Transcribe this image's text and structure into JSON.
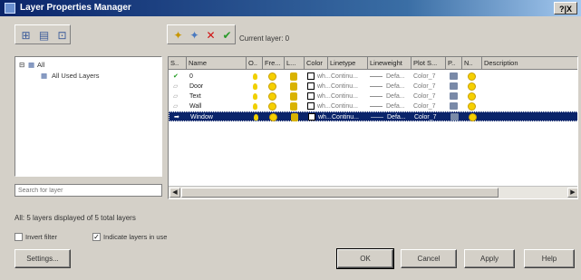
{
  "window": {
    "title": "Layer Properties Manager",
    "controls": "?|X"
  },
  "filter_toolbar": [
    {
      "icon": "new-property-filter-icon",
      "glyph": "⊞"
    },
    {
      "icon": "new-group-filter-icon",
      "glyph": "▤"
    },
    {
      "icon": "layer-states-icon",
      "glyph": "⊡"
    }
  ],
  "layer_toolbar": [
    {
      "icon": "new-layer-icon",
      "glyph": "✦",
      "color": "#c89600"
    },
    {
      "icon": "new-layer-vp-frozen-icon",
      "glyph": "✦",
      "color": "#4a7ac0"
    },
    {
      "icon": "delete-layer-icon",
      "glyph": "✕",
      "color": "#d01010"
    },
    {
      "icon": "set-current-icon",
      "glyph": "✔",
      "color": "#2a9a2a"
    }
  ],
  "current_layer": "Current layer: 0",
  "tree": {
    "root": "All",
    "child": "All Used Layers"
  },
  "search": {
    "placeholder": "Search for layer"
  },
  "columns": [
    "S..",
    "Name",
    "O..",
    "Fre...",
    "L...",
    "Color",
    "Linetype",
    "Lineweight",
    "Plot S...",
    "P..",
    "N..",
    "Description"
  ],
  "layers": [
    {
      "status": "current",
      "name": "0",
      "color": "wh...",
      "linetype": "Continu...",
      "lineweight": "Defa...",
      "plot_style": "Color_7",
      "selected": false
    },
    {
      "status": "",
      "name": "Door",
      "color": "wh...",
      "linetype": "Continu...",
      "lineweight": "Defa...",
      "plot_style": "Color_7",
      "selected": false
    },
    {
      "status": "",
      "name": "Text",
      "color": "wh...",
      "linetype": "Continu...",
      "lineweight": "Defa...",
      "plot_style": "Color_7",
      "selected": false
    },
    {
      "status": "",
      "name": "Wall",
      "color": "wh...",
      "linetype": "Continu...",
      "lineweight": "Defa...",
      "plot_style": "Color_7",
      "selected": false
    },
    {
      "status": "",
      "name": "Window",
      "color": "wh...",
      "linetype": "Continu...",
      "lineweight": "Defa...",
      "plot_style": "Color_7",
      "selected": true
    }
  ],
  "status_text": "All: 5 layers displayed of 5 total layers",
  "invert_filter": {
    "label": "Invert filter",
    "checked": false
  },
  "indicate_layers": {
    "label": "Indicate layers in use",
    "checked": true
  },
  "buttons": {
    "settings": "Settings...",
    "ok": "OK",
    "cancel": "Cancel",
    "apply": "Apply",
    "help": "Help"
  }
}
